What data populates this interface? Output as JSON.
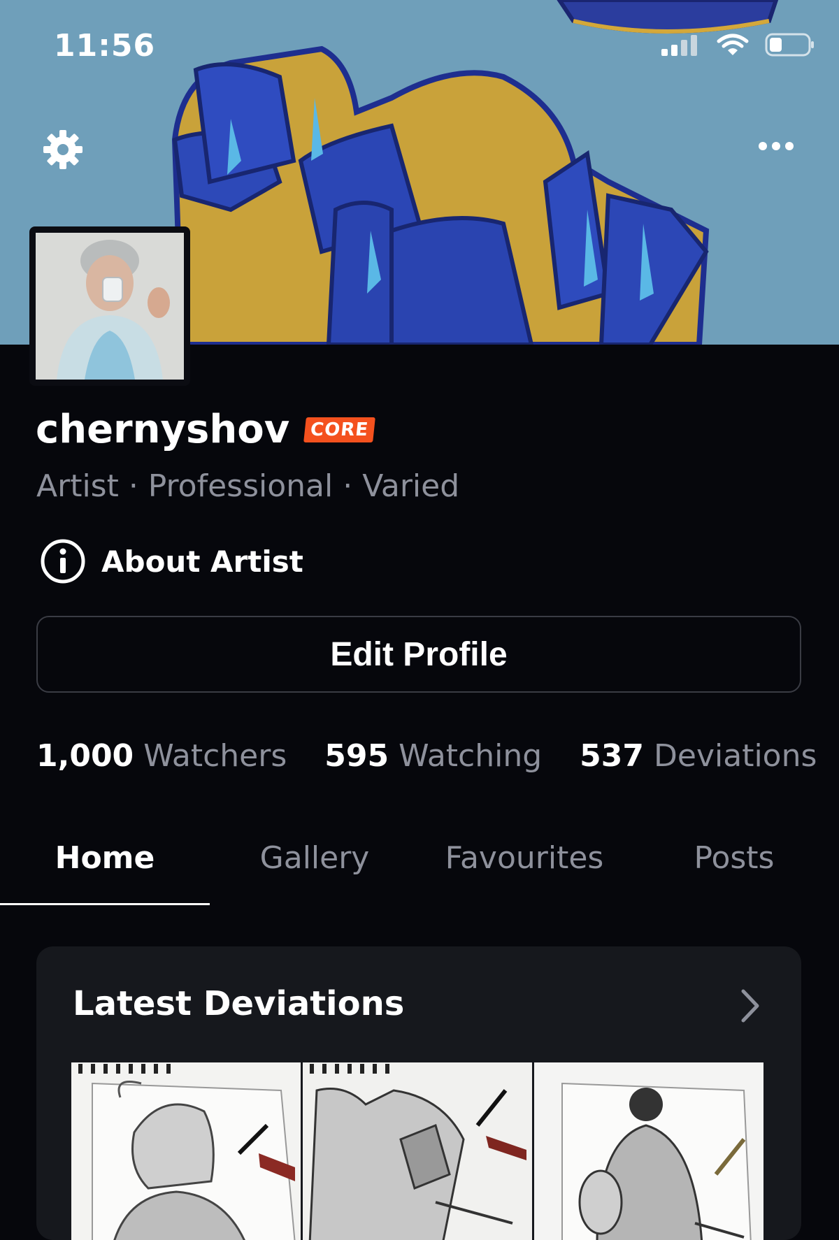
{
  "status_bar": {
    "time": "11:56"
  },
  "profile": {
    "username": "chernyshov",
    "badge": "CORE",
    "subtitle": "Artist · Professional · Varied",
    "about_label": "About Artist",
    "edit_label": "Edit Profile"
  },
  "stats": [
    {
      "value": "1,000",
      "label": "Watchers"
    },
    {
      "value": "595",
      "label": "Watching"
    },
    {
      "value": "537",
      "label": "Deviations"
    }
  ],
  "tabs": [
    {
      "label": "Home",
      "active": true
    },
    {
      "label": "Gallery",
      "active": false
    },
    {
      "label": "Favourites",
      "active": false
    },
    {
      "label": "Posts",
      "active": false
    }
  ],
  "latest": {
    "title": "Latest Deviations"
  },
  "colors": {
    "background": "#06070c",
    "card": "#16181d",
    "muted_text": "#8e919c",
    "badge": "#f4511e",
    "banner_sky": "#6f9fba"
  },
  "icons": [
    "settings-gear-icon",
    "more-dots-icon",
    "info-icon",
    "chevron-right-icon",
    "signal-icon",
    "wifi-icon",
    "battery-icon"
  ]
}
